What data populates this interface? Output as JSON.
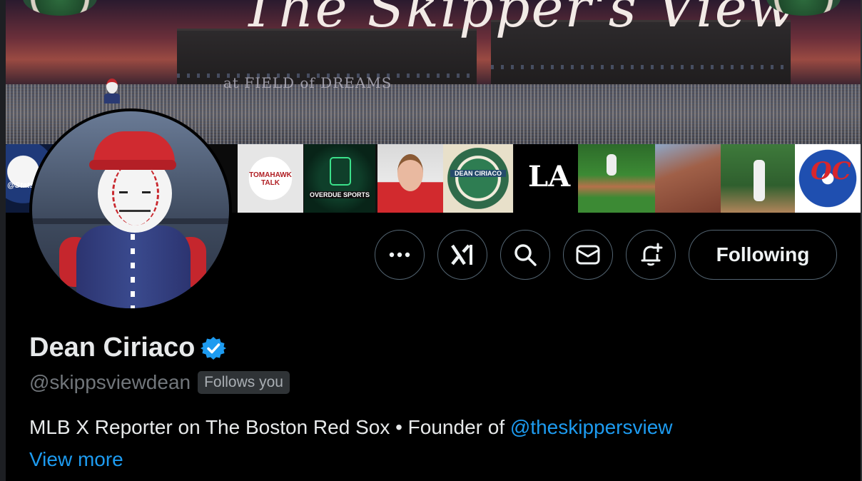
{
  "banner": {
    "title": "The Skipper's View",
    "venue_sign": "at FIELD of DREAMS",
    "tiles": [
      {
        "text": "@Stats"
      },
      {
        "text": "TOMAHAWK TALK"
      },
      {
        "text": "OVERDUE SPORTS"
      },
      {
        "text": ""
      },
      {
        "text": "DEAN CIRIACO"
      },
      {
        "text": "LA"
      },
      {
        "text": ""
      },
      {
        "text": ""
      },
      {
        "text": ""
      },
      {
        "text": "OC"
      }
    ]
  },
  "profile": {
    "display_name": "Dean Ciriaco",
    "handle": "@skippsviewdean",
    "follows_you": "Follows you",
    "bio_text": "MLB X Reporter on The Boston Red Sox • Founder of ",
    "bio_mention": "@theskippersview",
    "view_more": "View more"
  },
  "actions": {
    "more_icon": "more-icon",
    "grok_icon": "grok-icon",
    "search_icon": "search-icon",
    "message_icon": "mail-icon",
    "notify_icon": "bell-plus-icon",
    "following_label": "Following"
  },
  "colors": {
    "background": "#000000",
    "accent": "#1d9bf0",
    "secondary_text": "#71767b",
    "button_border": "#536471"
  }
}
